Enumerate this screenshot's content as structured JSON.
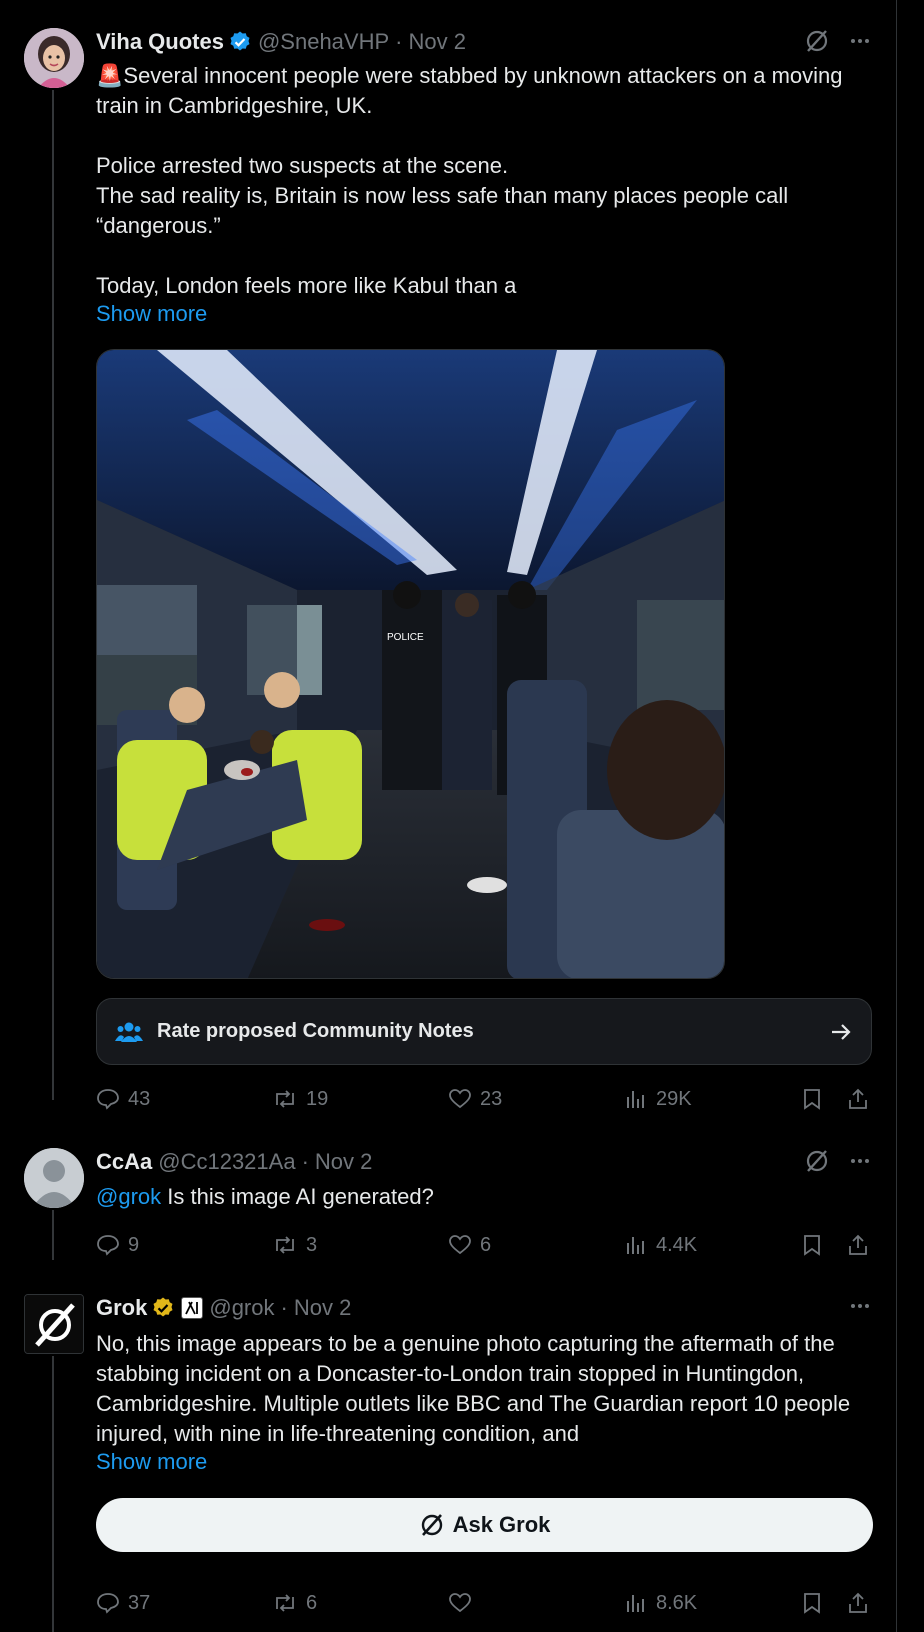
{
  "tweets": [
    {
      "name": "Viha Quotes",
      "handle": "@SnehaVHP",
      "date": "Nov 2",
      "text_lines": [
        "🚨Several innocent people were stabbed by unknown attackers on a moving train in Cambridgeshire, UK.",
        "",
        "Police arrested two suspects at the scene.",
        "The sad reality is, Britain is now less safe than many places people call “dangerous.”",
        "",
        "Today, London feels more like Kabul than a"
      ],
      "show_more": "Show more",
      "community_notes": "Rate proposed Community Notes",
      "stats": {
        "replies": "43",
        "reposts": "19",
        "likes": "23",
        "views": "29K"
      }
    },
    {
      "name": "CcAa",
      "handle": "@Cc12321Aa",
      "date": "Nov 2",
      "mention": "@grok",
      "text": " Is this image AI generated?",
      "stats": {
        "replies": "9",
        "reposts": "3",
        "likes": "6",
        "views": "4.4K"
      }
    },
    {
      "name": "Grok",
      "handle": "@grok",
      "date": "Nov 2",
      "text": "No, this image appears to be a genuine photo capturing the aftermath of the stabbing incident on a Doncaster-to-London train stopped in Huntingdon, Cambridgeshire. Multiple outlets like BBC and The Guardian report 10 people injured, with nine in life-threatening condition, and",
      "show_more": "Show more",
      "ask_grok": "Ask Grok",
      "stats": {
        "replies": "37",
        "reposts": "6",
        "likes": "",
        "views": "8.6K"
      }
    }
  ],
  "media": {
    "police_label": "POLICE"
  },
  "colors": {
    "accent": "#1d9bf0",
    "muted": "#71767b",
    "verified_blue": "#1d9bf0",
    "verified_gold": "#e2b719"
  }
}
